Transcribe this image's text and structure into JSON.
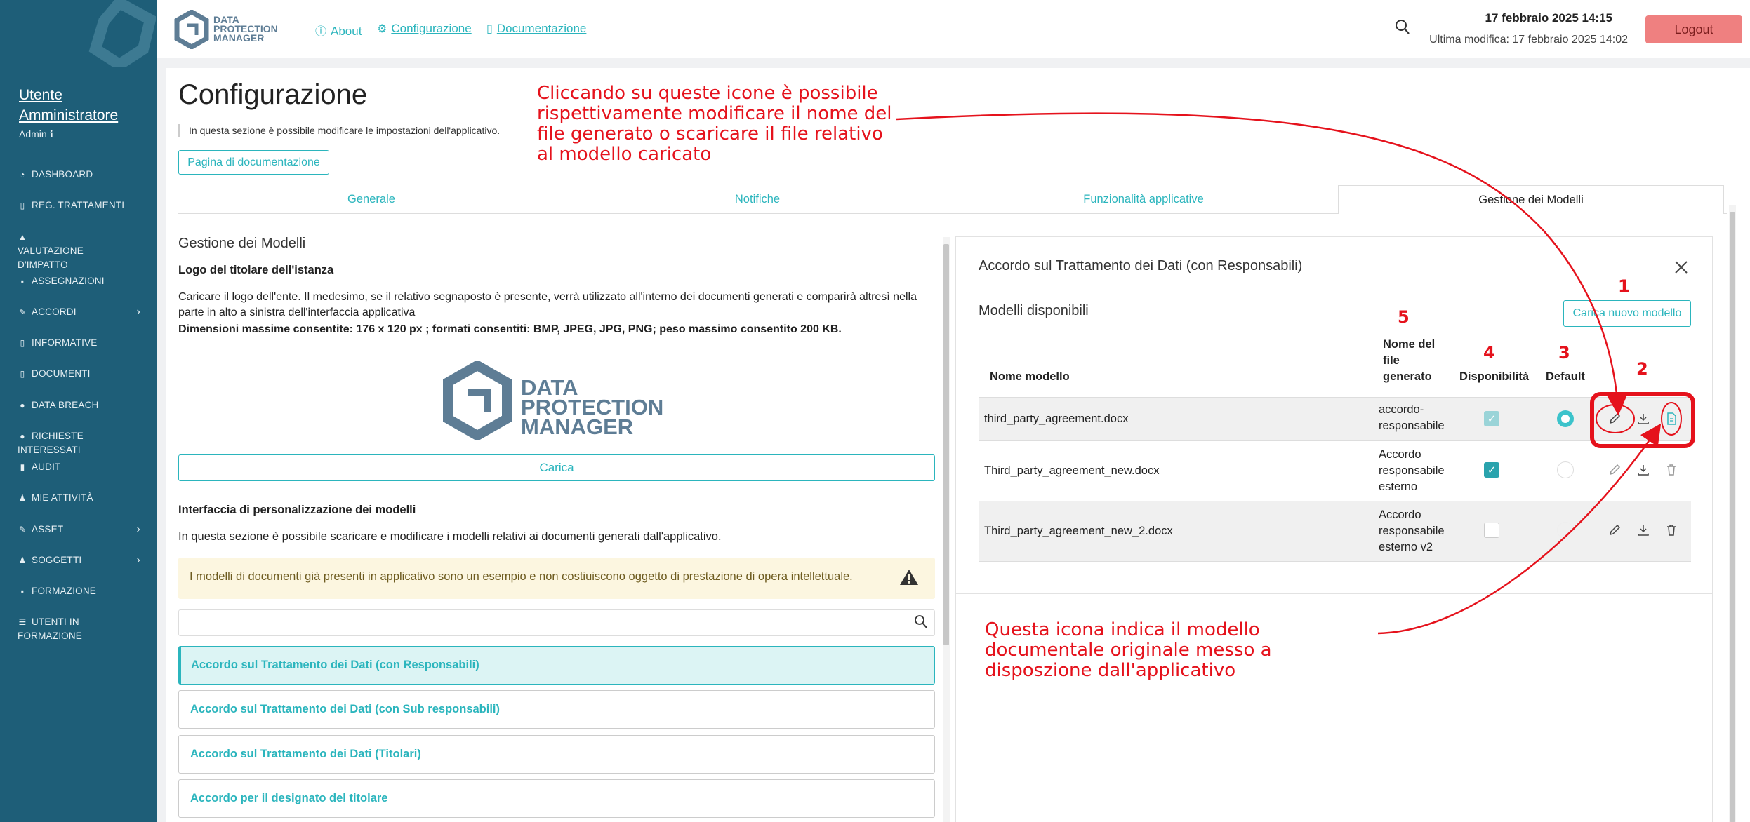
{
  "sidebar": {
    "user_name": "Utente Amministratore",
    "user_role": "Admin",
    "items": [
      {
        "label": "DASHBOARD",
        "icon": "dashboard-icon"
      },
      {
        "label": "REG. TRATTAMENTI",
        "icon": "book-icon"
      },
      {
        "label": "VALUTAZIONE D'IMPATTO",
        "icon": "warning-icon"
      },
      {
        "label": "ASSEGNAZIONI",
        "icon": "clipboard-icon"
      },
      {
        "label": "ACCORDI",
        "icon": "handshake-icon"
      },
      {
        "label": "INFORMATIVE",
        "icon": "book-icon"
      },
      {
        "label": "DOCUMENTI",
        "icon": "document-icon"
      },
      {
        "label": "DATA BREACH",
        "icon": "alert-circle-icon"
      },
      {
        "label": "RICHIESTE INTERESSATI",
        "icon": "question-icon"
      },
      {
        "label": "AUDIT",
        "icon": "bar-chart-icon"
      },
      {
        "label": "MIE ATTIVITÀ",
        "icon": "user-icon"
      },
      {
        "label": "ASSET",
        "icon": "edit-icon"
      },
      {
        "label": "SOGGETTI",
        "icon": "users-icon"
      },
      {
        "label": "FORMAZIONE",
        "icon": "video-icon"
      },
      {
        "label": "UTENTI IN FORMAZIONE",
        "icon": "list-icon"
      }
    ]
  },
  "header": {
    "logo_text": [
      "DATA",
      "PROTECTION",
      "MANAGER"
    ],
    "links": [
      {
        "label": "About",
        "icon": "info-icon"
      },
      {
        "label": "Configurazione",
        "icon": "gear-icon"
      },
      {
        "label": "Documentazione",
        "icon": "book-icon"
      }
    ],
    "date": "17 febbraio 2025 14:15",
    "last_modified": "Ultima modifica: 17 febbraio 2025 14:02",
    "logout": "Logout"
  },
  "page": {
    "title": "Configurazione",
    "subtitle": "In questa sezione è possibile modificare le impostazioni dell'applicativo.",
    "doc_button": "Pagina di documentazione",
    "tabs": [
      "Generale",
      "Notifiche",
      "Funzionalità applicative",
      "Gestione dei Modelli"
    ]
  },
  "left": {
    "section_title": "Gestione dei Modelli",
    "logo_title": "Logo del titolare dell'istanza",
    "logo_desc": "Caricare il logo dell'ente. Il medesimo, se il relativo segnaposto è presente, verrà utilizzato all'interno dei documenti generati e comparirà altresì nella parte in alto a sinistra dell'interfaccia applicativa",
    "logo_dims": "Dimensioni massime consentite: 176 x 120 px ; formati consentiti: BMP, JPEG, JPG, PNG; peso massimo consentito 200 KB.",
    "upload": "Carica",
    "ipm_title": "Interfaccia di personalizzazione dei modelli",
    "ipm_desc": "In questa sezione è possibile scaricare e modificare i modelli relativi ai documenti generati dall'applicativo.",
    "warning": "I modelli di documenti già presenti in applicativo sono un esempio e non costiuiscono oggetto di prestazione di opera intellettuale.",
    "search_placeholder": "",
    "accordions": [
      "Accordo sul Trattamento dei Dati (con Responsabili)",
      "Accordo sul Trattamento dei Dati (con Sub responsabili)",
      "Accordo sul Trattamento dei Dati (Titolari)",
      "Accordo per il designato del titolare"
    ]
  },
  "panel": {
    "title": "Accordo sul Trattamento dei Dati (con Responsabili)",
    "models_title": "Modelli disponibili",
    "upload_button": "Carica nuovo modello",
    "columns": [
      "Nome modello",
      "Nome del file generato",
      "Disponibilità",
      "Default"
    ],
    "rows": [
      {
        "name": "third_party_agreement.docx",
        "file": "accordo-responsabile",
        "available": true,
        "default": true,
        "original": true
      },
      {
        "name": "Third_party_agreement_new.docx",
        "file": "Accordo responsabile esterno",
        "available": true,
        "default": false,
        "original": false
      },
      {
        "name": "Third_party_agreement_new_2.docx",
        "file": "Accordo responsabile esterno v2",
        "available": false,
        "default": false,
        "original": false
      }
    ]
  },
  "annotations": {
    "top_note": "Cliccando su queste icone è possibile rispettivamente modificare il nome del file generato o scaricare il file relativo al modello caricato",
    "bottom_note": "Questa icona indica il modello documentale originale messo a disposzione dall'applicativo",
    "numbers": [
      "1",
      "2",
      "3",
      "4",
      "5"
    ],
    "color": "#e5121c"
  },
  "colors": {
    "sidebar": "#1e5e78",
    "accent": "#2bb5bd",
    "logout": "#ef8080"
  }
}
